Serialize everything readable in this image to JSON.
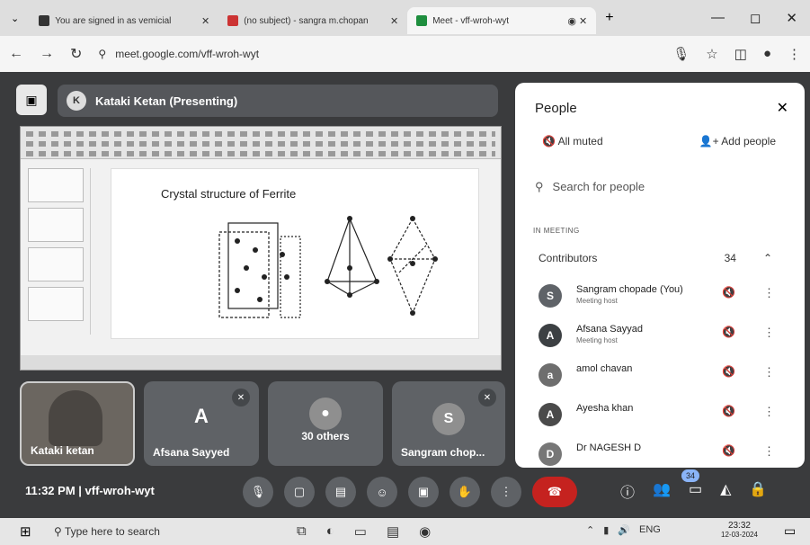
{
  "tabs": [
    {
      "title": "You are signed in as vemicial"
    },
    {
      "title": "(no subject) - sangra m.chopan"
    },
    {
      "title": "Meet - vff-wroh-wyt"
    }
  ],
  "address": {
    "url": "meet.google.com/vff-wroh-wyt"
  },
  "presenter": {
    "label": "Kataki Ketan (Presenting)"
  },
  "slide": {
    "title": "Crystal structure of Ferrite"
  },
  "tiles": [
    {
      "name": "Kataki ketan"
    },
    {
      "name": "Afsana Sayyed",
      "initial": "A"
    },
    {
      "name": "30 others"
    },
    {
      "name": "Sangram chop...",
      "initial": "S"
    }
  ],
  "meeting": {
    "time": "11:32 PM",
    "separator": "|",
    "code": "vff-wroh-wyt",
    "people_badge": "34"
  },
  "people_panel": {
    "title": "People",
    "all_muted": "All muted",
    "add_people": "Add people",
    "search_placeholder": "Search for people",
    "section_label": "IN MEETING",
    "group_label": "Contributors",
    "group_count": "34",
    "participants": [
      {
        "name": "Sangram chopade (You)",
        "role": "Meeting host",
        "initial": "S"
      },
      {
        "name": "Afsana Sayyad",
        "role": "Meeting host",
        "initial": "A"
      },
      {
        "name": "amol chavan",
        "role": "",
        "initial": "a"
      },
      {
        "name": "Ayesha khan",
        "role": "",
        "initial": "A"
      },
      {
        "name": "Dr NAGESH D",
        "role": "",
        "initial": "D"
      }
    ]
  },
  "taskbar": {
    "search": "Type here to search",
    "lang": "ENG",
    "time": "23:32",
    "date": "12-03-2024"
  }
}
